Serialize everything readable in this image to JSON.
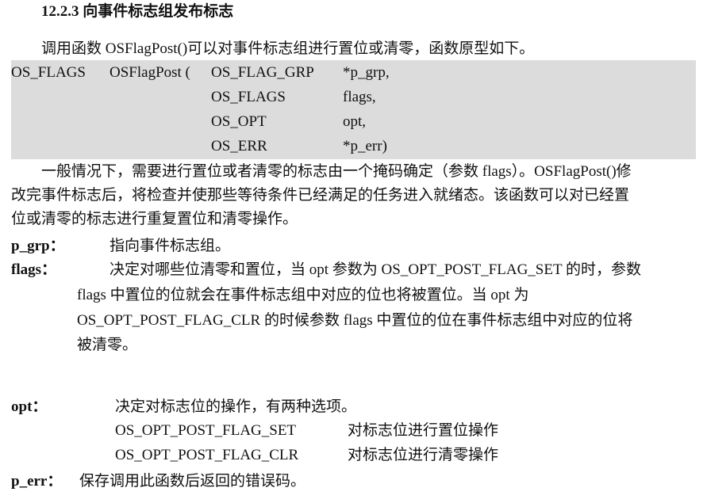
{
  "section": {
    "heading": "12.2.3 向事件标志组发布标志",
    "intro": "调用函数 OSFlagPost()可以对事件标志组进行置位或清零，函数原型如下。"
  },
  "prototype": {
    "rows": [
      {
        "ret": "OS_FLAGS",
        "name": "OSFlagPost (",
        "type": "OS_FLAG_GRP",
        "param": "*p_grp,"
      },
      {
        "ret": "",
        "name": "",
        "type": "OS_FLAGS",
        "param": "flags,"
      },
      {
        "ret": "",
        "name": "",
        "type": "OS_OPT",
        "param": "opt,"
      },
      {
        "ret": "",
        "name": "",
        "type": "OS_ERR",
        "param": "*p_err)"
      }
    ]
  },
  "description": {
    "line1": "一般情况下，需要进行置位或者清零的标志由一个掩码确定（参数 flags）。OSFlagPost()修",
    "line2": "改完事件标志后，将检查并使那些等待条件已经满足的任务进入就绪态。该函数可以对已经置",
    "line3": "位或清零的标志进行重复置位和清零操作。"
  },
  "params": {
    "p_grp": {
      "term": "p_grp：",
      "text": "指向事件标志组。"
    },
    "flags": {
      "term": "flags：",
      "line1": "决定对哪些位清零和置位，当 opt 参数为 OS_OPT_POST_FLAG_SET 的时，参数",
      "line2": "flags 中置位的位就会在事件标志组中对应的位也将被置位。当 opt 为",
      "line3": "OS_OPT_POST_FLAG_CLR 的时候参数 flags 中置位的位在事件标志组中对应的位将",
      "line4": "被清零。"
    },
    "opt": {
      "term": "opt：",
      "text": "决定对标志位的操作，有两种选项。",
      "options": [
        {
          "name": "OS_OPT_POST_FLAG_SET",
          "desc": "对标志位进行置位操作"
        },
        {
          "name": "OS_OPT_POST_FLAG_CLR",
          "desc": "对标志位进行清零操作"
        }
      ]
    },
    "p_err": {
      "term": "p_err：",
      "text": "保存调用此函数后返回的错误码。"
    }
  }
}
